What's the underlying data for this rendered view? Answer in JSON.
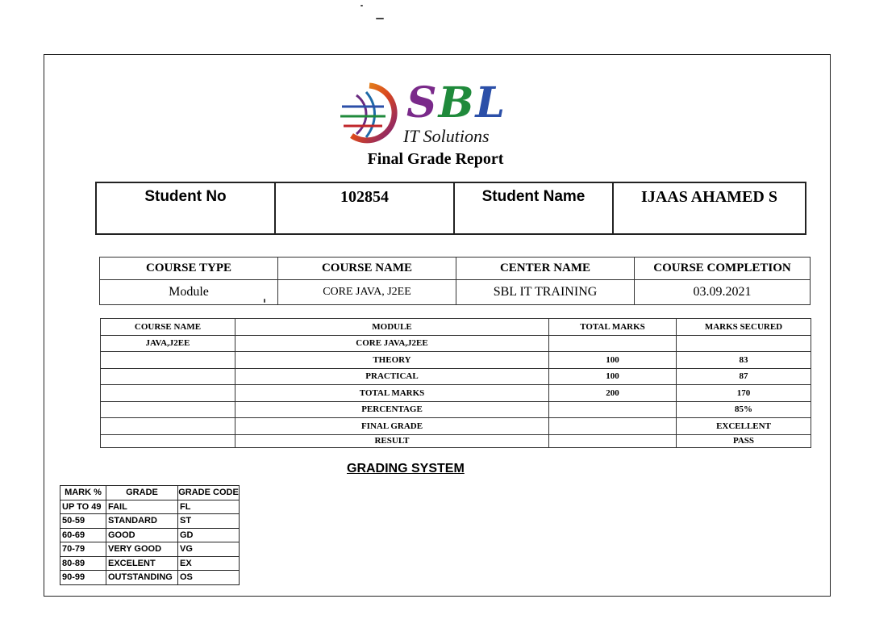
{
  "header": {
    "logo_title": "SBL",
    "logo_subtitle": "IT Solutions",
    "report_title": "Final Grade Report"
  },
  "student": {
    "no_label": "Student No",
    "no_value": "102854",
    "name_label": "Student Name",
    "name_value": "IJAAS AHAMED S"
  },
  "course_info": {
    "headers": [
      "COURSE TYPE",
      "COURSE NAME",
      "CENTER NAME",
      "COURSE COMPLETION"
    ],
    "values": [
      "Module",
      "CORE JAVA, J2EE",
      "SBL IT TRAINING",
      "03.09.2021"
    ]
  },
  "marks_table": {
    "headers": [
      "COURSE NAME",
      "MODULE",
      "TOTAL MARKS",
      "MARKS SECURED"
    ],
    "rows": [
      [
        "JAVA,J2EE",
        "CORE JAVA,J2EE",
        "",
        ""
      ],
      [
        "",
        "THEORY",
        "100",
        "83"
      ],
      [
        "",
        "PRACTICAL",
        "100",
        "87"
      ],
      [
        "",
        "TOTAL MARKS",
        "200",
        "170"
      ],
      [
        "",
        "PERCENTAGE",
        "",
        "85%"
      ],
      [
        "",
        "FINAL GRADE",
        "",
        "EXCELLENT"
      ],
      [
        "",
        "RESULT",
        "",
        "PASS"
      ]
    ]
  },
  "grading": {
    "title": "GRADING SYSTEM",
    "headers": [
      "MARK %",
      "GRADE",
      "GRADE CODE"
    ],
    "rows": [
      [
        "UP TO 49",
        "FAIL",
        "FL"
      ],
      [
        "50-59",
        "STANDARD",
        "ST"
      ],
      [
        "60-69",
        "GOOD",
        "GD"
      ],
      [
        "70-79",
        "VERY GOOD",
        "VG"
      ],
      [
        "80-89",
        "EXCELENT",
        "EX"
      ],
      [
        "90-99",
        "OUTSTANDING",
        "OS"
      ]
    ]
  },
  "colors": {
    "logo_s": "#7a2a8a",
    "logo_b": "#1f8a3b",
    "logo_l": "#2b4fa8"
  }
}
